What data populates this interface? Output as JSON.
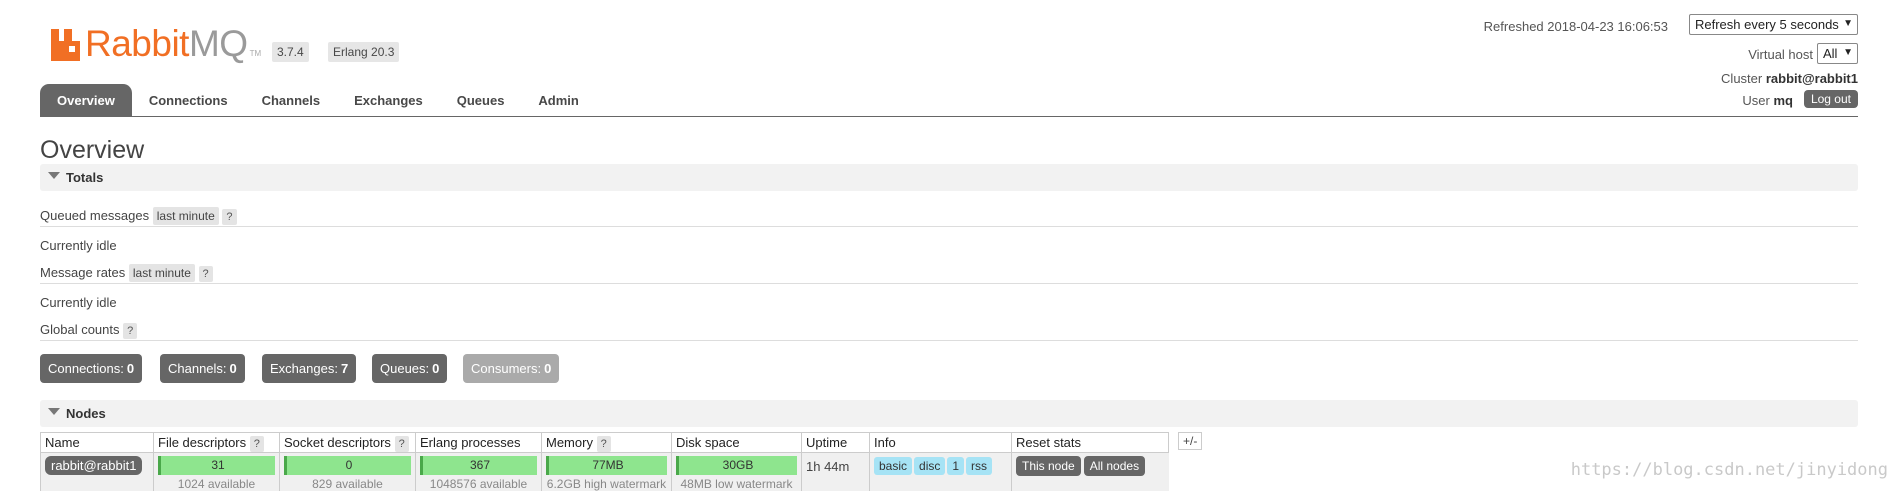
{
  "header": {
    "logo_text_orange": "Rabbit",
    "logo_text_grey": "MQ",
    "logo_tm": "TM",
    "version": "3.7.4",
    "erlang": "Erlang 20.3",
    "refreshed_label": "Refreshed",
    "refreshed_time": "2018-04-23 16:06:53",
    "refresh_select": "Refresh every 5 seconds",
    "vhost_label": "Virtual host",
    "vhost_value": "All",
    "cluster_label": "Cluster",
    "cluster_value": "rabbit@rabbit1",
    "user_label": "User",
    "user_value": "mq",
    "logout_label": "Log out"
  },
  "tabs": [
    {
      "label": "Overview"
    },
    {
      "label": "Connections"
    },
    {
      "label": "Channels"
    },
    {
      "label": "Exchanges"
    },
    {
      "label": "Queues"
    },
    {
      "label": "Admin"
    }
  ],
  "page_title": "Overview",
  "totals": {
    "section_label": "Totals",
    "queued_label": "Queued messages",
    "queued_chip": "last minute",
    "help": "?",
    "idle1": "Currently idle",
    "rates_label": "Message rates",
    "rates_chip": "last minute",
    "idle2": "Currently idle",
    "global_label": "Global counts",
    "counts": [
      {
        "label": "Connections:",
        "value": "0"
      },
      {
        "label": "Channels:",
        "value": "0"
      },
      {
        "label": "Exchanges:",
        "value": "7"
      },
      {
        "label": "Queues:",
        "value": "0"
      },
      {
        "label": "Consumers:",
        "value": "0"
      }
    ]
  },
  "nodes": {
    "section_label": "Nodes",
    "columns": [
      "Name",
      "File descriptors",
      "Socket descriptors",
      "Erlang processes",
      "Memory",
      "Disk space",
      "Uptime",
      "Info",
      "Reset stats"
    ],
    "plusminus": "+/-",
    "row": {
      "name": "rabbit@rabbit1",
      "fd": "31",
      "fd_sub": "1024 available",
      "sd": "0",
      "sd_sub": "829 available",
      "ep": "367",
      "ep_sub": "1048576 available",
      "mem": "77MB",
      "mem_sub": "6.2GB high watermark",
      "disk": "30GB",
      "disk_sub": "48MB low watermark",
      "uptime": "1h 44m",
      "info": [
        "basic",
        "disc",
        "1",
        "rss"
      ],
      "reset_this": "This node",
      "reset_all": "All nodes"
    }
  },
  "watermark": "https://blog.csdn.net/jinyidong",
  "colors": {
    "brand_orange": "#f16f24",
    "tab_active": "#666666",
    "bar_green": "#8ee58e",
    "info_blue": "#a6e3f5"
  }
}
